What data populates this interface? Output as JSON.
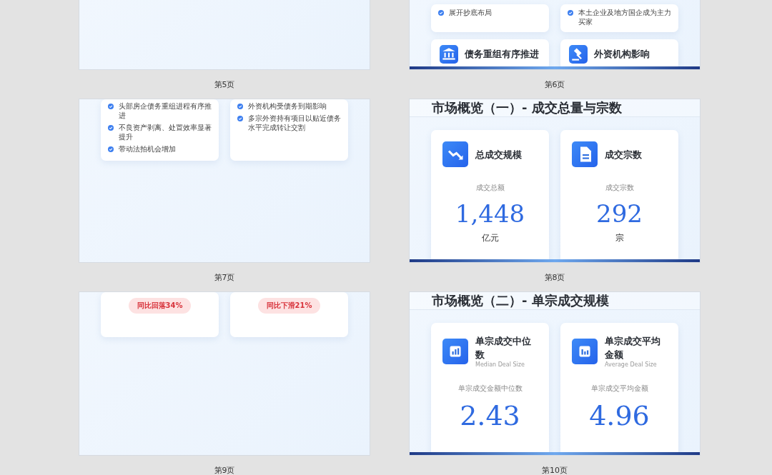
{
  "slides": [
    {
      "label": "第5页"
    },
    {
      "label": "第6页",
      "footer_bar": true,
      "rows": [
        [
          {
            "kind": "bullets",
            "bullets": [
              "展开抄底布局"
            ]
          },
          {
            "kind": "bullets",
            "bullets": [
              "本土企业及地方国企成为主力买家"
            ]
          }
        ],
        [
          {
            "kind": "topic",
            "title": "债务重组有序推进"
          },
          {
            "kind": "topic",
            "title": "外资机构影响"
          }
        ]
      ]
    },
    {
      "label": "第7页",
      "rows": [
        [
          {
            "kind": "bullets",
            "bullets": [
              "头部房企债务重组进程有序推进",
              "不良资产剥离、处置效率显著提升",
              "带动法拍机会增加"
            ]
          },
          {
            "kind": "bullets",
            "bullets": [
              "外资机构受债务到期影响",
              "多宗外资持有项目以贴近债务水平完成转让交割"
            ]
          }
        ]
      ]
    },
    {
      "label": "第8页",
      "footer_bar": true,
      "title": "市场概览（一）- 成交总量与宗数",
      "rows": [
        [
          {
            "kind": "metric",
            "title": "总成交规模",
            "caption": "成交总额",
            "value": "1,448",
            "unit": "亿元"
          },
          {
            "kind": "metric",
            "title": "成交宗数",
            "caption": "成交宗数",
            "value": "292",
            "unit": "宗"
          }
        ]
      ]
    },
    {
      "label": "第9页",
      "rows": [
        [
          {
            "kind": "badge",
            "badge": "同比回落34%"
          },
          {
            "kind": "badge",
            "badge": "同比下滑21%"
          }
        ]
      ]
    },
    {
      "label": "第10页",
      "footer_bar": true,
      "title": "市场概览（二）- 单宗成交规模",
      "rows": [
        [
          {
            "kind": "metric",
            "title": "单宗成交中位数",
            "subtitle": "Median Deal Size",
            "caption": "单宗成交金额中位数",
            "value": "2.43"
          },
          {
            "kind": "metric",
            "title": "单宗成交平均金额",
            "subtitle": "Average Deal Size",
            "caption": "单宗成交平均金额",
            "value": "4.96"
          }
        ]
      ]
    }
  ]
}
